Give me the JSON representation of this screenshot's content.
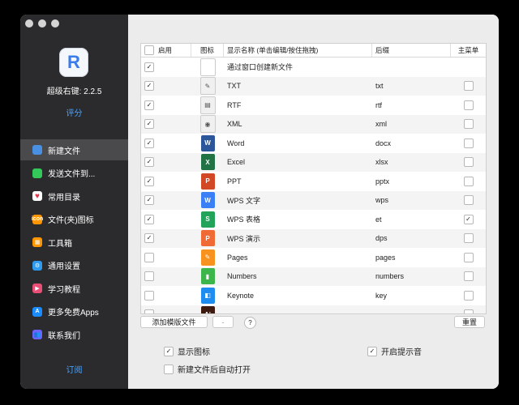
{
  "app": {
    "version": "超级右键: 2.2.5",
    "rate_label": "评分",
    "subscribe_label": "订阅",
    "icon_letter": "R"
  },
  "sidebar": {
    "items": [
      {
        "label": "新建文件",
        "icon": "new-file-icon",
        "color": "#4a90e2",
        "glyph": "",
        "active": true
      },
      {
        "label": "发送文件到...",
        "icon": "send-file-icon",
        "color": "#34c759",
        "glyph": "",
        "active": false
      },
      {
        "label": "常用目录",
        "icon": "heart-icon",
        "color": "#ffffff",
        "glyph": "♥",
        "active": false
      },
      {
        "label": "文件(夹)图标",
        "icon": "folder-icon-icon",
        "color": "#ff9500",
        "glyph": "icon",
        "active": false
      },
      {
        "label": "工具箱",
        "icon": "toolbox-icon",
        "color": "#ff9500",
        "glyph": "▦",
        "active": false
      },
      {
        "label": "通用设置",
        "icon": "gear-icon",
        "color": "#2e9bf0",
        "glyph": "⚙",
        "active": false
      },
      {
        "label": "学习教程",
        "icon": "tutorial-icon",
        "color": "#e94e77",
        "glyph": "▶",
        "active": false
      },
      {
        "label": "更多免费Apps",
        "icon": "app-store-icon",
        "color": "#1a8cff",
        "glyph": "A",
        "active": false
      },
      {
        "label": "联系我们",
        "icon": "contact-icon",
        "color": "#6c63ff",
        "glyph": "👥",
        "active": false
      }
    ]
  },
  "table": {
    "headers": {
      "enabled": "启用",
      "icon": "图标",
      "name": "显示名称 (单击编辑/按住拖拽)",
      "ext": "后缀",
      "menu": "主菜单"
    },
    "rows": [
      {
        "enabled": true,
        "icon": "blank-file-icon",
        "color": "#ffffff",
        "glyph": "",
        "name": "通过窗口创建新文件",
        "ext": "",
        "menu": null
      },
      {
        "enabled": true,
        "icon": "txt-file-icon",
        "color": "#f0f0f0",
        "glyph": "✎",
        "name": "TXT",
        "ext": "txt",
        "menu": false
      },
      {
        "enabled": true,
        "icon": "rtf-file-icon",
        "color": "#f0f0f0",
        "glyph": "▤",
        "name": "RTF",
        "ext": "rtf",
        "menu": false
      },
      {
        "enabled": true,
        "icon": "xml-file-icon",
        "color": "#f0f0f0",
        "glyph": "◉",
        "name": "XML",
        "ext": "xml",
        "menu": false
      },
      {
        "enabled": true,
        "icon": "word-icon",
        "color": "#2b579a",
        "glyph": "W",
        "name": "Word",
        "ext": "docx",
        "menu": false
      },
      {
        "enabled": true,
        "icon": "excel-icon",
        "color": "#217346",
        "glyph": "X",
        "name": "Excel",
        "ext": "xlsx",
        "menu": false
      },
      {
        "enabled": true,
        "icon": "powerpoint-icon",
        "color": "#d24726",
        "glyph": "P",
        "name": "PPT",
        "ext": "pptx",
        "menu": false
      },
      {
        "enabled": true,
        "icon": "wps-writer-icon",
        "color": "#3a7ff6",
        "glyph": "W",
        "name": "WPS 文字",
        "ext": "wps",
        "menu": false
      },
      {
        "enabled": true,
        "icon": "wps-sheet-icon",
        "color": "#22a35a",
        "glyph": "S",
        "name": "WPS 表格",
        "ext": "et",
        "menu": true
      },
      {
        "enabled": true,
        "icon": "wps-presentation-icon",
        "color": "#f06a35",
        "glyph": "P",
        "name": "WPS 演示",
        "ext": "dps",
        "menu": false
      },
      {
        "enabled": false,
        "icon": "pages-icon",
        "color": "#f7921e",
        "glyph": "✎",
        "name": "Pages",
        "ext": "pages",
        "menu": false
      },
      {
        "enabled": false,
        "icon": "numbers-icon",
        "color": "#3cb54a",
        "glyph": "▮",
        "name": "Numbers",
        "ext": "numbers",
        "menu": false
      },
      {
        "enabled": false,
        "icon": "keynote-icon",
        "color": "#1f8cf0",
        "glyph": "◧",
        "name": "Keynote",
        "ext": "key",
        "menu": false
      },
      {
        "enabled": false,
        "icon": "adobe-icon",
        "color": "#3d1b10",
        "glyph": "Ai",
        "name": "",
        "ext": "",
        "menu": false
      }
    ]
  },
  "buttons": {
    "add_template": "添加模版文件",
    "remove": "-",
    "help": "?",
    "reset": "重置"
  },
  "options": {
    "show_icon": {
      "label": "显示图标",
      "checked": true
    },
    "sound": {
      "label": "开启提示音",
      "checked": true
    },
    "auto_open": {
      "label": "新建文件后自动打开",
      "checked": false
    }
  }
}
